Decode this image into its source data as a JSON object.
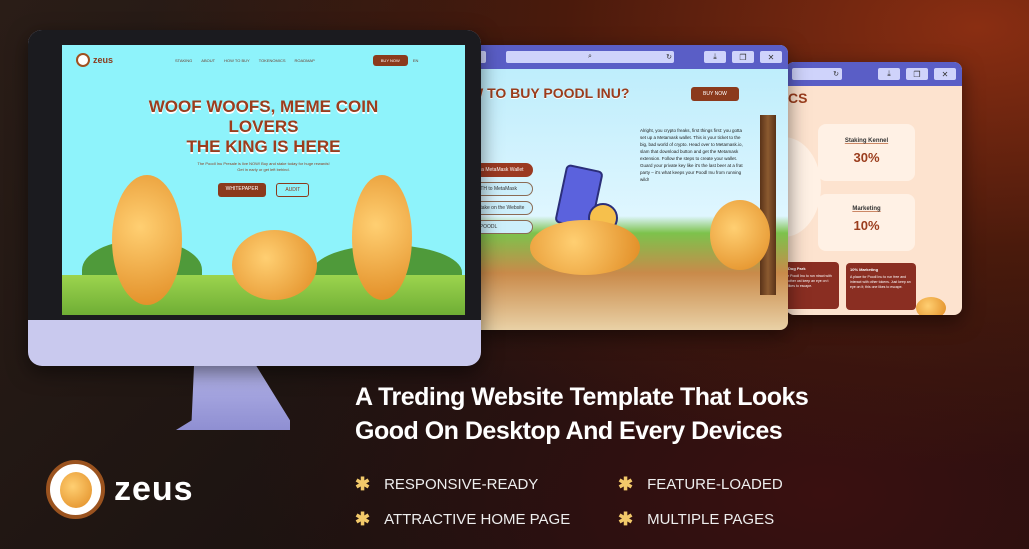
{
  "monitor_site": {
    "brand": "zeus",
    "nav": [
      "STAKING",
      "ABOUT",
      "HOW TO BUY",
      "TOKENOMICS",
      "ROADMAP"
    ],
    "buy_now": "BUY NOW",
    "lang": "EN",
    "hero_title_1": "WOOF WOOFS, MEME COIN",
    "hero_title_2": "LOVERS",
    "hero_title_3": "THE KING IS HERE",
    "hero_sub_1": "The Poodl Inu Presale is live NOW! Buy and stake today for huge rewards!",
    "hero_sub_2": "Get in early or get left behind.",
    "whitepaper": "WHITEPAPER",
    "audit": "AUDIT"
  },
  "window_how_to_buy": {
    "title": "W TO BUY POODL INU?",
    "buy_now": "BUY NOW",
    "steps": [
      "e a MetaMask Wallet",
      "ETH to MetaMask",
      "Stake on the Website",
      "$POODL"
    ],
    "body": "Alright, you crypto freaks, first things first: you gotta set up a Metamask wallet. This is your ticket to the big, bad world of crypto. Head over to Metamask.io, slam that download button and get the Metamask extension. Follow the steps to create your wallet. Guard your private key like it's the last beer at a frat party – it's what keeps your Poodl Inu from running wild!"
  },
  "window_tokenomics": {
    "title": "CS",
    "cards": [
      {
        "label": "Staking Kennel",
        "value": "30%"
      },
      {
        "label": "Marketing",
        "value": "10%"
      }
    ],
    "info": [
      {
        "title": "Dog Park",
        "text": "r Poodl Inu to run ntract with other ust keep an eye on t likes to escape."
      },
      {
        "title": "10% Marketing",
        "text": "A place for Poodl Inu to run free and interact with other tokens. Just keep an eye on it; this one likes to escape."
      }
    ]
  },
  "headline_1": "A Treding Website Template That Looks",
  "headline_2": "Good On Desktop And Every Devices",
  "features": [
    "RESPONSIVE-READY",
    "FEATURE-LOADED",
    "ATTRACTIVE HOME PAGE",
    "MULTIPLE PAGES"
  ],
  "brand": "zeus",
  "colors": {
    "brand": "#8b3a1c",
    "accent": "#f2c96a",
    "window_bar": "#5a5ec6",
    "screen": "#8ef3fb"
  }
}
